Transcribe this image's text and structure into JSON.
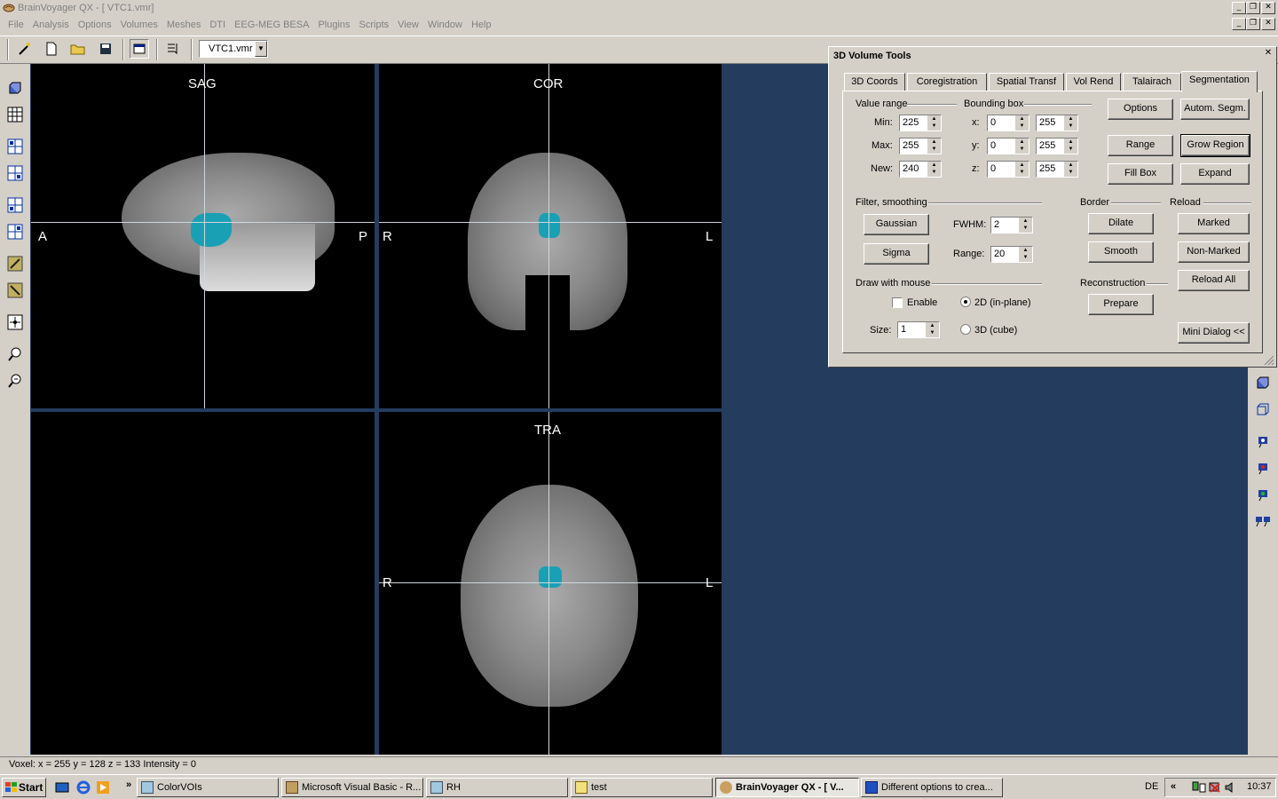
{
  "window": {
    "title": "BrainVoyager QX - [ VTC1.vmr]"
  },
  "menu": [
    "File",
    "Analysis",
    "Options",
    "Volumes",
    "Meshes",
    "DTI",
    "EEG-MEG BESA",
    "Plugins",
    "Scripts",
    "View",
    "Window",
    "Help"
  ],
  "toolbar": {
    "file_combo": "VTC1.vmr"
  },
  "views": {
    "sag": {
      "label": "SAG",
      "left": "A",
      "right": "P"
    },
    "cor": {
      "label": "COR",
      "left": "R",
      "right": "L"
    },
    "tra": {
      "label": "TRA",
      "left": "R",
      "right": "L"
    }
  },
  "dialog": {
    "title": "3D Volume Tools",
    "tabs": [
      "3D Coords",
      "Coregistration",
      "Spatial Transf",
      "Vol Rend",
      "Talairach",
      "Segmentation"
    ],
    "active_tab": "Segmentation",
    "value_range": {
      "label": "Value range",
      "min_label": "Min:",
      "min": "225",
      "max_label": "Max:",
      "max": "255",
      "new_label": "New:",
      "new": "240"
    },
    "bbox": {
      "label": "Bounding box",
      "x_label": "x:",
      "x0": "0",
      "x1": "255",
      "y_label": "y:",
      "y0": "0",
      "y1": "255",
      "z_label": "z:",
      "z0": "0",
      "z1": "255"
    },
    "buttons": {
      "options": "Options",
      "autom_segm": "Autom. Segm.",
      "range": "Range",
      "grow_region": "Grow Region",
      "fill_box": "Fill Box",
      "expand": "Expand"
    },
    "filter": {
      "label": "Filter, smoothing",
      "gaussian": "Gaussian",
      "sigma": "Sigma",
      "fwhm_label": "FWHM:",
      "fwhm": "2",
      "range_label": "Range:",
      "range": "20"
    },
    "border": {
      "label": "Border",
      "dilate": "Dilate",
      "smooth": "Smooth"
    },
    "reload": {
      "label": "Reload",
      "marked": "Marked",
      "non_marked": "Non-Marked",
      "reload_all": "Reload All"
    },
    "draw": {
      "label": "Draw with mouse",
      "enable": "Enable",
      "enable_checked": false,
      "mode_2d": "2D (in-plane)",
      "mode_3d": "3D (cube)",
      "selected_mode": "2D (in-plane)",
      "size_label": "Size:",
      "size": "1"
    },
    "reconstruction": {
      "label": "Reconstruction",
      "prepare": "Prepare"
    },
    "mini_dialog": "Mini Dialog <<"
  },
  "status": {
    "text": "Voxel:  x = 255  y = 128  z = 133   Intensity = 0"
  },
  "taskbar": {
    "start": "Start",
    "tasks": [
      "ColorVOIs",
      "Microsoft Visual Basic - R...",
      "RH",
      "test",
      "BrainVoyager QX - [ V...",
      "Different options to crea..."
    ],
    "active_task": "BrainVoyager QX - [ V...",
    "lang": "DE",
    "clock": "10:37"
  },
  "colors": {
    "roi": "#1aa0b4",
    "workspace": "#243c5e",
    "chrome": "#d4d0c8"
  }
}
